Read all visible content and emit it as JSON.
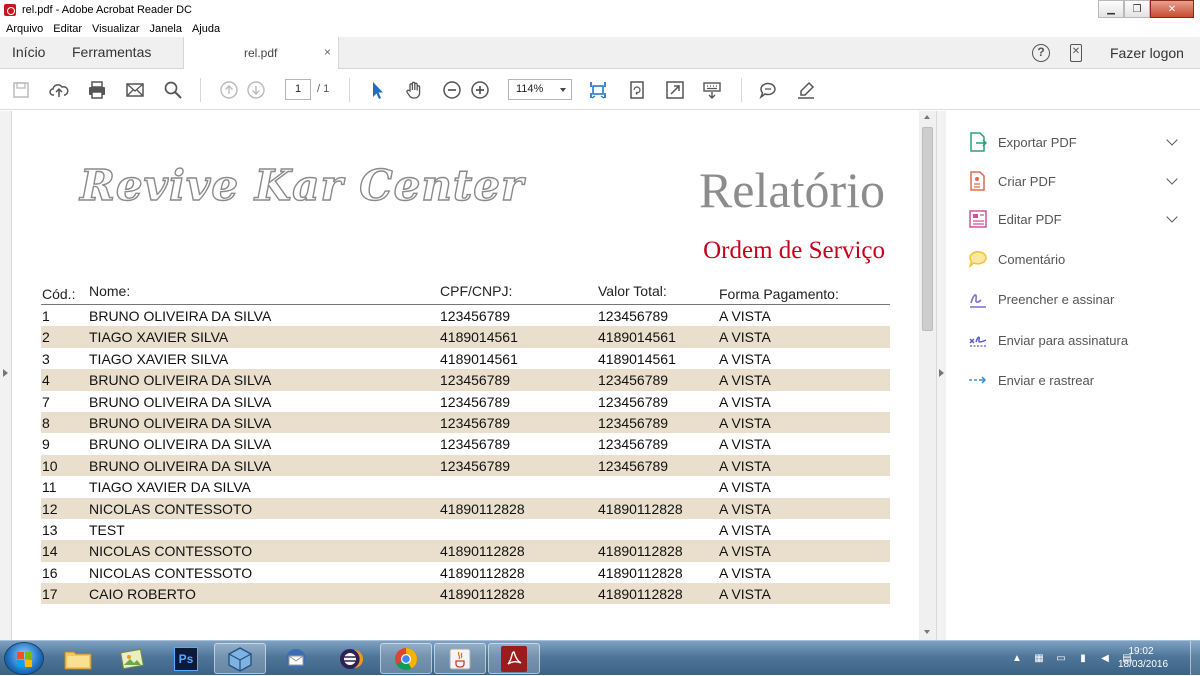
{
  "window": {
    "title": "rel.pdf - Adobe Acrobat Reader DC"
  },
  "menu": [
    "Arquivo",
    "Editar",
    "Visualizar",
    "Janela",
    "Ajuda"
  ],
  "tabs": {
    "home": "Início",
    "tools": "Ferramentas",
    "document": "rel.pdf",
    "close": "×"
  },
  "header": {
    "help": "?",
    "logon": "Fazer logon"
  },
  "toolbar": {
    "page_current": "1",
    "page_total": "/ 1",
    "zoom": "114%"
  },
  "document": {
    "logo": "Revive Kar Center",
    "title": "Relatório",
    "subtitle": "Ordem de Serviço",
    "columns": [
      "Cód.:",
      "Nome:",
      "CPF/CNPJ:",
      "Valor Total:",
      "Forma Pagamento:"
    ],
    "rows": [
      [
        "1",
        "BRUNO OLIVEIRA DA SILVA",
        "123456789",
        "123456789",
        "A VISTA"
      ],
      [
        "2",
        "TIAGO XAVIER SILVA",
        "4189014561",
        "4189014561",
        "A VISTA"
      ],
      [
        "3",
        "TIAGO XAVIER SILVA",
        "4189014561",
        "4189014561",
        "A VISTA"
      ],
      [
        "4",
        "BRUNO OLIVEIRA DA SILVA",
        "123456789",
        "123456789",
        "A VISTA"
      ],
      [
        "7",
        "BRUNO OLIVEIRA DA SILVA",
        "123456789",
        "123456789",
        "A VISTA"
      ],
      [
        "8",
        "BRUNO OLIVEIRA DA SILVA",
        "123456789",
        "123456789",
        "A VISTA"
      ],
      [
        "9",
        "BRUNO OLIVEIRA DA SILVA",
        "123456789",
        "123456789",
        "A VISTA"
      ],
      [
        "10",
        "BRUNO OLIVEIRA DA SILVA",
        "123456789",
        "123456789",
        "A VISTA"
      ],
      [
        "11",
        "TIAGO XAVIER DA SILVA",
        "",
        "",
        "A VISTA"
      ],
      [
        "12",
        "NICOLAS CONTESSOTO",
        "41890112828",
        "41890112828",
        "A VISTA"
      ],
      [
        "13",
        "TEST",
        "",
        "",
        "A VISTA"
      ],
      [
        "14",
        "NICOLAS CONTESSOTO",
        "41890112828",
        "41890112828",
        "A VISTA"
      ],
      [
        "16",
        "NICOLAS CONTESSOTO",
        "41890112828",
        "41890112828",
        "A VISTA"
      ],
      [
        "17",
        "CAIO ROBERTO",
        "41890112828",
        "41890112828",
        "A VISTA"
      ]
    ],
    "row_alt_color": "#e9dfcc",
    "subtitle_color": "#c8001c"
  },
  "right_panel": [
    {
      "label": "Exportar PDF",
      "icon": "export-pdf-icon",
      "color": "#2b9f7a",
      "expandable": true
    },
    {
      "label": "Criar PDF",
      "icon": "create-pdf-icon",
      "color": "#e06a4f",
      "expandable": true
    },
    {
      "label": "Editar PDF",
      "icon": "edit-pdf-icon",
      "color": "#d4509a",
      "expandable": true
    },
    {
      "label": "Comentário",
      "icon": "comment-icon",
      "color": "#f2c230",
      "expandable": false
    },
    {
      "label": "Preencher e assinar",
      "icon": "fill-sign-icon",
      "color": "#7a6fd0",
      "expandable": false
    },
    {
      "label": "Enviar para assinatura",
      "icon": "send-signature-icon",
      "color": "#5a5ac8",
      "expandable": false
    },
    {
      "label": "Enviar e rastrear",
      "icon": "send-track-icon",
      "color": "#3b8fd6",
      "expandable": false
    }
  ],
  "taskbar": {
    "apps": [
      "explorer-icon",
      "photos-icon",
      "photoshop-icon",
      "virtualbox-icon",
      "thunderbird-icon",
      "eclipse-icon",
      "chrome-icon",
      "java-icon",
      "acrobat-icon"
    ],
    "photoshop_label": "Ps",
    "clock_time": "19:02",
    "clock_date": "18/03/2016"
  }
}
